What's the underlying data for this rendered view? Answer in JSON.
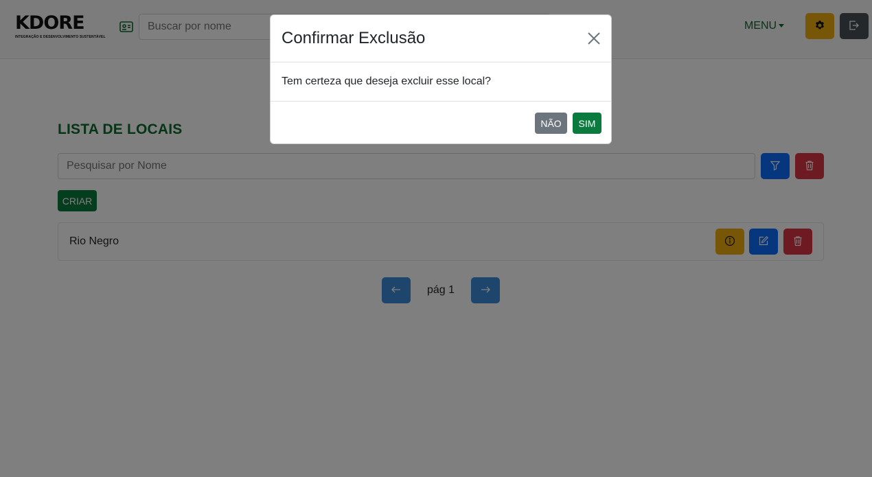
{
  "navbar": {
    "logo_text": "KDORE",
    "logo_subtitle": "INTEGRAÇÃO E DESENVOLVIMENTO SUSTENTÁVEL",
    "search_placeholder": "Buscar por nome",
    "menu_label": "MENU"
  },
  "main": {
    "title": "LISTA DE LOCAIS",
    "search_placeholder": "Pesquisar por Nome",
    "create_label": "CRIAR",
    "items": [
      {
        "name": "Rio Negro"
      }
    ],
    "pagination": {
      "label": "pág 1"
    }
  },
  "modal": {
    "title": "Confirmar Exclusão",
    "message": "Tem certeza que deseja excluir esse local?",
    "no_label": "NÃO",
    "yes_label": "SIM"
  },
  "colors": {
    "brand_green": "#0b6b2d",
    "primary_blue": "#0d6efd",
    "danger_red": "#dc3545",
    "warning_yellow": "#f0ad0e",
    "secondary_gray": "#6c757d"
  },
  "icons": {
    "id_card": "id-card-icon",
    "gear": "gear-icon",
    "logout": "logout-icon",
    "filter": "filter-icon",
    "trash": "trash-icon",
    "info": "info-icon",
    "edit": "edit-icon",
    "arrow_left": "arrow-left-icon",
    "arrow_right": "arrow-right-icon",
    "close": "close-icon"
  }
}
